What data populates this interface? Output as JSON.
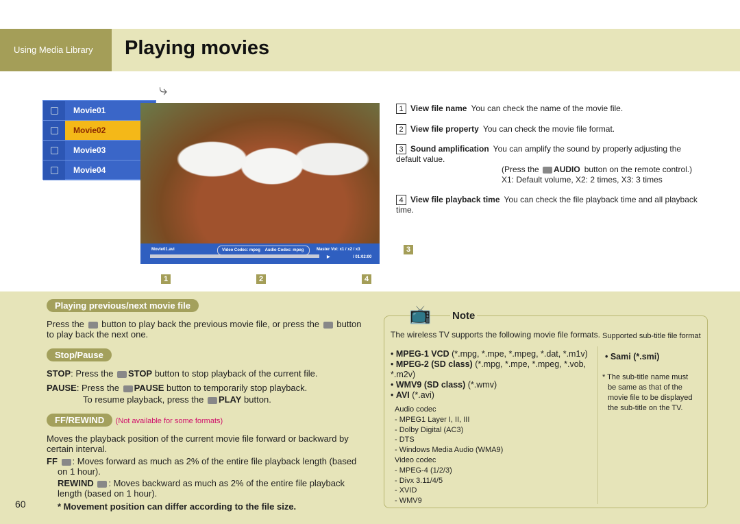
{
  "header": {
    "section": "Using Media Library",
    "title": "Playing movies"
  },
  "movie_list": [
    "Movie01",
    "Movie02",
    "Movie03",
    "Movie04"
  ],
  "selected_index": 1,
  "player": {
    "file": "Movie01.avi",
    "video_codec": "Video Codec: mpeg",
    "audio_codec": "Audio Codec: mpeg",
    "volume": "Master Vol: x1 / x2 / x3",
    "time": "/ 01:02:00"
  },
  "callouts": [
    "1",
    "2",
    "3",
    "4"
  ],
  "features": [
    {
      "n": "1",
      "title": "View file name",
      "desc": "You can check the name of the movie file."
    },
    {
      "n": "2",
      "title": "View file property",
      "desc": "You can check the movie file format."
    },
    {
      "n": "3",
      "title": "Sound amplification",
      "desc": "You can amplify the sound by properly adjusting the default value.",
      "extra1": "(Press the",
      "extra_icon": "AUDIO",
      "extra2": "button on the remote control.)",
      "extra3": "X1: Default volume, X2: 2 times, X3: 3 times"
    },
    {
      "n": "4",
      "title": "View file playback time",
      "desc": "You can check the file playback time and all playback time."
    }
  ],
  "prevnext": {
    "heading": "Playing previous/next movie file",
    "t1": "Press the",
    "t2": "button to play back the previous movie file, or press the",
    "t3": "button to play back the next one."
  },
  "stoppause": {
    "heading": "Stop/Pause",
    "stop_label": "STOP",
    "stop_t1": ": Press the",
    "stop_btn": "STOP",
    "stop_t2": "button to stop playback of the current file.",
    "pause_label": "PAUSE",
    "pause_t1": ": Press the",
    "pause_btn": "PAUSE",
    "pause_t2": "button to temporarily stop playback.",
    "resume_t1": "To resume playback, press the",
    "play_btn": "PLAY",
    "resume_t2": "button."
  },
  "ffrew": {
    "heading": "FF/REWIND",
    "note": "(Not available for some formats)",
    "intro": "Moves the playback position of the current movie file forward or backward by certain interval.",
    "ff_label": "FF",
    "ff_text": ": Moves forward as much as 2% of the entire file playback length (based on 1 hour).",
    "rew_label": "REWIND",
    "rew_text": ": Moves backward as much as 2% of the entire file playback length (based on 1 hour).",
    "warning": "* Movement position can differ according to the file size."
  },
  "note": {
    "title": "Note",
    "intro": "The wireless TV supports the following movie file formats.",
    "formats": [
      {
        "b": "MPEG-1 VCD",
        "r": "(*.mpg, *.mpe, *.mpeg, *.dat, *.m1v)"
      },
      {
        "b": "MPEG-2 (SD class)",
        "r": "(*.mpg, *.mpe, *.mpeg, *.vob, *.m2v)"
      },
      {
        "b": "WMV9 (SD class)",
        "r": "(*.wmv)"
      },
      {
        "b": "AVI",
        "r": "(*.avi)"
      }
    ],
    "codecs": [
      "Audio codec",
      "- MPEG1 Layer I, II,  III",
      "- Dolby Digital (AC3)",
      "- DTS",
      "- Windows Media Audio (WMA9)",
      "Video codec",
      "- MPEG-4 (1/2/3)",
      "- Divx 3.11/4/5",
      "- XVID",
      "- WMV9"
    ],
    "sub_title": "Supported sub-title file format",
    "sub_format": "• Sami (*.smi)",
    "sub_note": "* The sub-title name must be same as that of the movie file to be displayed the sub-title on the TV."
  },
  "page_number": "60",
  "colors": {
    "olive": "#a49e58",
    "cream": "#e6e4b9",
    "menu_blue": "#3a66c8",
    "highlight": "#f4b818",
    "magenta": "#d0106a"
  }
}
